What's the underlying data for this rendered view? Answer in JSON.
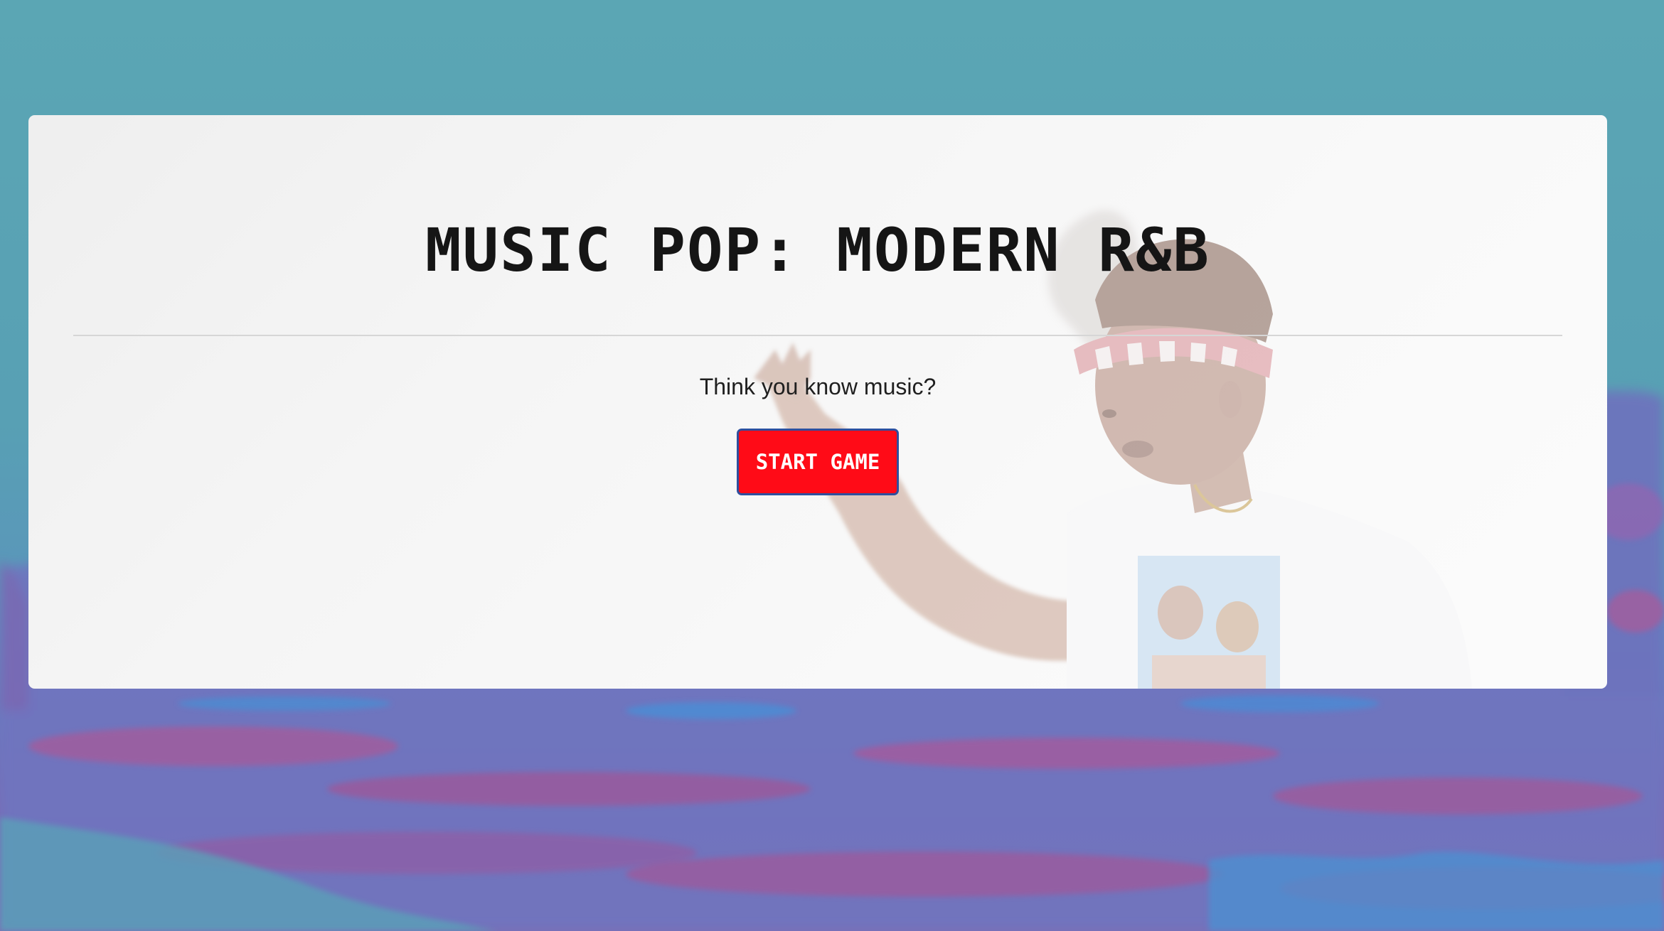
{
  "page": {
    "title": "MUSIC POP: MODERN R&B",
    "tagline": "Think you know music?",
    "start_button_label": "START GAME"
  },
  "colors": {
    "background_top": "#59a3b3",
    "background_bottom": "#7f6cb2",
    "card": "#f4f4f4",
    "title_text": "#151515",
    "button_fill": "#ff0b17",
    "button_border": "#2e4f9e",
    "button_text": "#ffffff"
  },
  "images": {
    "hero_photo": "person-in-headband-photo",
    "background": "teal-purple-painted-scenery"
  }
}
